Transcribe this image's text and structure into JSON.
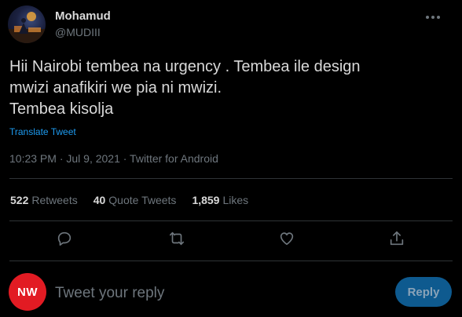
{
  "author": {
    "name": "Mohamud",
    "handle": "@MUDIII",
    "avatar_icon": "profile-photo-icon"
  },
  "tweet": {
    "lines": [
      "Hii Nairobi tembea na urgency . Tembea ile design",
      "mwizi anafikiri we pia ni mwizi.",
      "Tembea kisolja"
    ],
    "translate_label": "Translate Tweet",
    "meta": "10:23 PM · Jul 9, 2021 · Twitter for Android"
  },
  "stats": {
    "retweets": {
      "count": "522",
      "label": "Retweets"
    },
    "quote_tweets": {
      "count": "40",
      "label": "Quote Tweets"
    },
    "likes": {
      "count": "1,859",
      "label": "Likes"
    }
  },
  "actions": {
    "reply_icon": "reply-icon",
    "retweet_icon": "retweet-icon",
    "like_icon": "heart-icon",
    "share_icon": "share-icon"
  },
  "composer": {
    "avatar_text": "NW",
    "placeholder": "Tweet your reply",
    "reply_label": "Reply"
  },
  "colors": {
    "background": "#000000",
    "text": "#d9d9d9",
    "muted": "#6e767d",
    "link": "#1d9bf0",
    "reply_button": "#0e5a8f",
    "reply_avatar": "#e21b23"
  }
}
